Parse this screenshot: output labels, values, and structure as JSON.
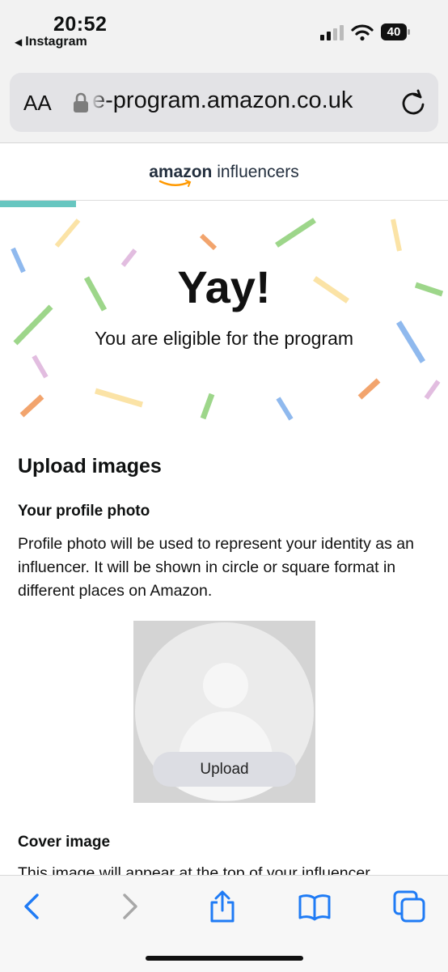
{
  "status_bar": {
    "time": "20:52",
    "back_app": "Instagram",
    "back_arrow": "◀",
    "battery": "40"
  },
  "browser": {
    "text_size_label": "AA",
    "url": "e-program.amazon.co.uk",
    "lock_icon": "lock-icon",
    "reload_icon": "reload-icon"
  },
  "brand": {
    "name_bold": "amazon",
    "name_rest": " influencers"
  },
  "hero": {
    "title": "Yay!",
    "subtitle": "You are eligible for the program"
  },
  "upload": {
    "heading": "Upload images",
    "profile_heading": "Your profile photo",
    "profile_description": "Profile photo will be used to represent your identity as an influencer. It will be shown in circle or square format in different places on Amazon.",
    "upload_button": "Upload",
    "cover_heading": "Cover image",
    "cover_description": "This image will appear at the top of your influencer"
  },
  "colors": {
    "progress": "#67c6c0",
    "confetti_green": "#9dd68a",
    "confetti_yellow": "#fbe3a6",
    "confetti_blue": "#8fb9ee",
    "confetti_orange": "#f2a46d",
    "confetti_pink": "#e2bde0",
    "ios_blue": "#1f7bf5"
  }
}
